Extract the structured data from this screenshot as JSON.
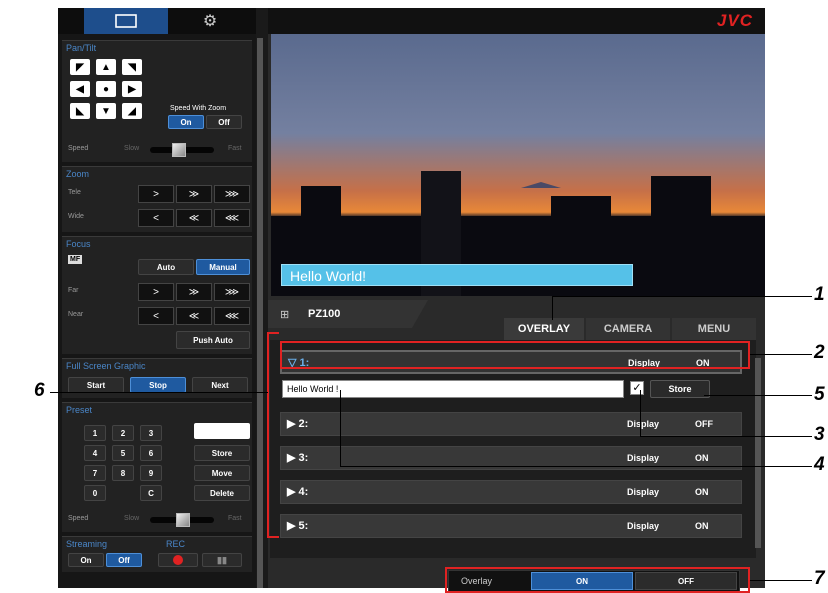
{
  "app": {
    "logo": "JVC"
  },
  "sidebar": {
    "pantilt": {
      "title": "Pan/Tilt",
      "speed_with_zoom_label": "Speed With Zoom",
      "on_label": "On",
      "off_label": "Off",
      "speed_label": "Speed",
      "slow_label": "Slow",
      "fast_label": "Fast"
    },
    "zoom": {
      "title": "Zoom",
      "tele_label": "Tele",
      "wide_label": "Wide"
    },
    "focus": {
      "title": "Focus",
      "mf_label": "MF",
      "auto_label": "Auto",
      "manual_label": "Manual",
      "far_label": "Far",
      "near_label": "Near",
      "push_auto_label": "Push Auto"
    },
    "fullscreen": {
      "title": "Full Screen Graphic",
      "start_label": "Start",
      "stop_label": "Stop",
      "next_label": "Next"
    },
    "preset": {
      "title": "Preset",
      "numbers": [
        "1",
        "2",
        "3",
        "4",
        "5",
        "6",
        "7",
        "8",
        "9",
        "0",
        "C"
      ],
      "store_label": "Store",
      "move_label": "Move",
      "delete_label": "Delete",
      "speed_label": "Speed",
      "slow_label": "Slow",
      "fast_label": "Fast"
    },
    "streaming": {
      "title": "Streaming",
      "rec_title": "REC",
      "on_label": "On",
      "off_label": "Off"
    }
  },
  "video": {
    "overlay_text": "Hello World!"
  },
  "camera": {
    "name": "PZ100"
  },
  "tabs": [
    {
      "label": "OVERLAY"
    },
    {
      "label": "CAMERA"
    },
    {
      "label": "MENU"
    }
  ],
  "overlay": {
    "rows": [
      {
        "num": "1:",
        "display": "Display",
        "state": "ON"
      },
      {
        "num": "2:",
        "display": "Display",
        "state": "OFF"
      },
      {
        "num": "3:",
        "display": "Display",
        "state": "ON"
      },
      {
        "num": "4:",
        "display": "Display",
        "state": "ON"
      },
      {
        "num": "5:",
        "display": "Display",
        "state": "ON"
      }
    ],
    "text_value": "Hello World !",
    "store_label": "Store",
    "overlay_label": "Overlay",
    "on_label": "ON",
    "off_label": "OFF"
  },
  "callouts": [
    "1",
    "2",
    "3",
    "4",
    "5",
    "6",
    "7"
  ],
  "colors": {
    "accent": "#1f5aa0",
    "callout_frame": "#e02222",
    "overlay_bar": "#55c1e8"
  }
}
